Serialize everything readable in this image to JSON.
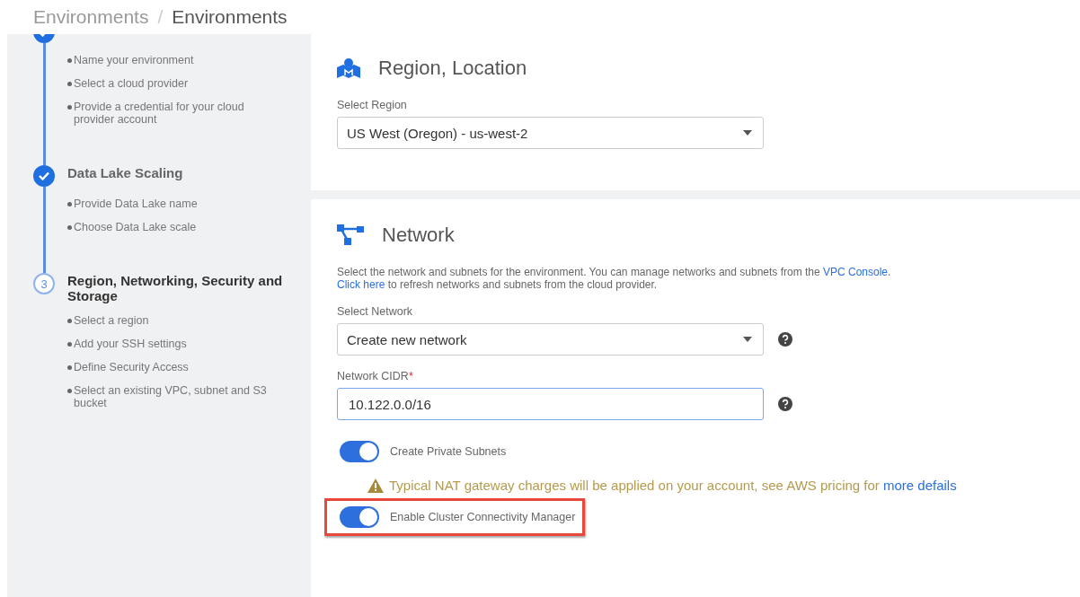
{
  "breadcrumb": [
    "Environments",
    "Environments"
  ],
  "breadcrumb_separator": "/",
  "steps": [
    {
      "completed": true,
      "items": [
        "Name your environment",
        "Select a cloud provider",
        "Provide a credential for your cloud provider account"
      ]
    },
    {
      "title": "Data Lake Scaling",
      "completed": true,
      "items": [
        "Provide Data Lake name",
        "Choose Data Lake scale"
      ]
    },
    {
      "title": "Region, Networking, Security and Storage",
      "completed": false,
      "number": "3",
      "items": [
        "Select a region",
        "Add your SSH settings",
        "Define Security Access",
        "Select an existing VPC, subnet and S3 bucket"
      ]
    }
  ],
  "region": {
    "title": "Region, Location",
    "label": "Select Region",
    "value": "US West (Oregon) - us-west-2"
  },
  "network": {
    "title": "Network",
    "description": [
      [
        {
          "kind": "text",
          "text": "Select the network and subnets for the environment. You can manage networks and subnets from the "
        },
        {
          "kind": "link",
          "text": "VPC Console"
        },
        {
          "kind": "text",
          "text": "."
        }
      ],
      [
        {
          "kind": "link",
          "text": "Click here"
        },
        {
          "kind": "text",
          "text": " to refresh networks and subnets from the cloud provider."
        }
      ]
    ],
    "fields": [
      {
        "kind": "select",
        "label": "Select Network",
        "value": "Create new network",
        "focused": false
      },
      {
        "kind": "input",
        "label": "Network CIDR",
        "required_mark": "*",
        "value": "10.122.0.0/16",
        "focused": true
      }
    ],
    "toggles": [
      {
        "label": "Create Private Subnets",
        "on": true,
        "highlighted": false,
        "warning": {
          "text": "Typical NAT gateway charges will be applied on your account, see AWS pricing for ",
          "link": "more defails"
        }
      },
      {
        "label": "Enable Cluster Connectivity Manager",
        "on": true,
        "highlighted": true
      }
    ]
  }
}
